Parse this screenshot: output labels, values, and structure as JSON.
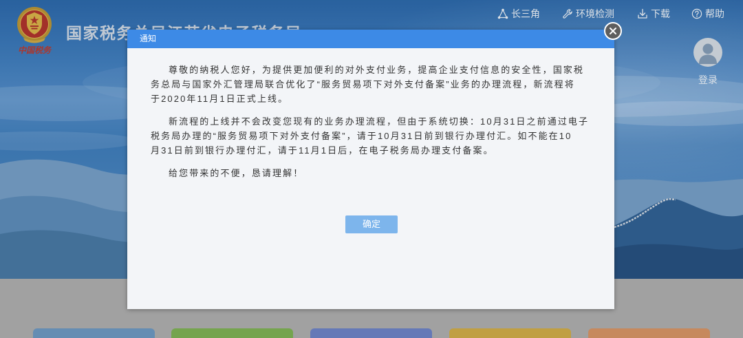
{
  "header": {
    "logo_icon": "tax-emblem-icon",
    "logo_lettering": "中国税务",
    "site_title": "国家税务总局江苏省电子税务局",
    "nav": [
      {
        "label": "长三角",
        "icon": "triangle-network-icon"
      },
      {
        "label": "环境检测",
        "icon": "wrench-icon"
      },
      {
        "label": "下载",
        "icon": "download-icon"
      },
      {
        "label": "帮助",
        "icon": "help-circle-icon"
      }
    ],
    "avatar_icon": "user-avatar-icon",
    "login_label": "登录"
  },
  "notice_modal": {
    "title": "通知",
    "close_icon": "close-icon",
    "paragraphs": [
      {
        "lines": [
          "尊敬的纳税人您好，为提供更加便利的对外支付业务，提高企业支付信息的安全性，国家税",
          "务总局与国家外汇管理局联合优化了“服务贸易项下对外支付备案”业务的办理流程，新流程将",
          "于2020年11月1日正式上线。"
        ]
      },
      {
        "lines": [
          "新流程的上线并不会改变您现有的业务办理流程，但由于系统切换：10月31日之前通过电子",
          "税务局办理的“服务贸易项下对外支付备案”，请于10月31日前到银行办理付汇。如不能在10",
          "月31日前到银行办理付汇，请于11月1日后，在电子税务局办理支付备案。"
        ]
      },
      {
        "lines": [
          "给您带来的不便，恳请理解！"
        ]
      }
    ],
    "confirm_label": "确定"
  },
  "colors": {
    "modal_header": "#3d8ae6",
    "confirm_button": "#7db5ec",
    "close_button": "#5e5e5e",
    "modal_body": "#f3f5f8",
    "cards": [
      "#6a93bb",
      "#7aab52",
      "#6a7ebf",
      "#c8a646",
      "#cf8f62"
    ]
  }
}
